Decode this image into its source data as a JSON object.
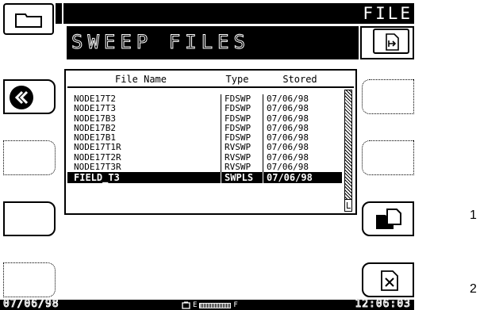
{
  "header": {
    "title": "FILE"
  },
  "panel": {
    "title": "SWEEP FILES"
  },
  "table": {
    "columns": [
      "File Name",
      "Type",
      "Stored"
    ],
    "rows": [
      [
        "NODE17T2",
        "FDSWP",
        "07/06/98"
      ],
      [
        "NODE17T3",
        "FDSWP",
        "07/06/98"
      ],
      [
        "NODE17B3",
        "FDSWP",
        "07/06/98"
      ],
      [
        "NODE17B2",
        "FDSWP",
        "07/06/98"
      ],
      [
        "NODE17B1",
        "FDSWP",
        "07/06/98"
      ],
      [
        "NODE17T1R",
        "RVSWP",
        "07/06/98"
      ],
      [
        "NODE17T2R",
        "RVSWP",
        "07/06/98"
      ],
      [
        "NODE17T3R",
        "RVSWP",
        "07/06/98"
      ],
      [
        "FIELD_T3",
        "SWPLS",
        "07/06/98"
      ]
    ],
    "selected_index": 8
  },
  "status": {
    "date": "07/06/98",
    "battery_empty": "E",
    "battery_full": "F",
    "time": "12:06:03"
  },
  "callouts": {
    "c1": "1",
    "c2": "2"
  },
  "icons": {
    "folder": "folder-icon",
    "back": "double-chevron-left-icon",
    "export": "file-export-icon",
    "copy": "copy-file-icon",
    "delete": "delete-file-icon",
    "battery": "battery-icon"
  }
}
